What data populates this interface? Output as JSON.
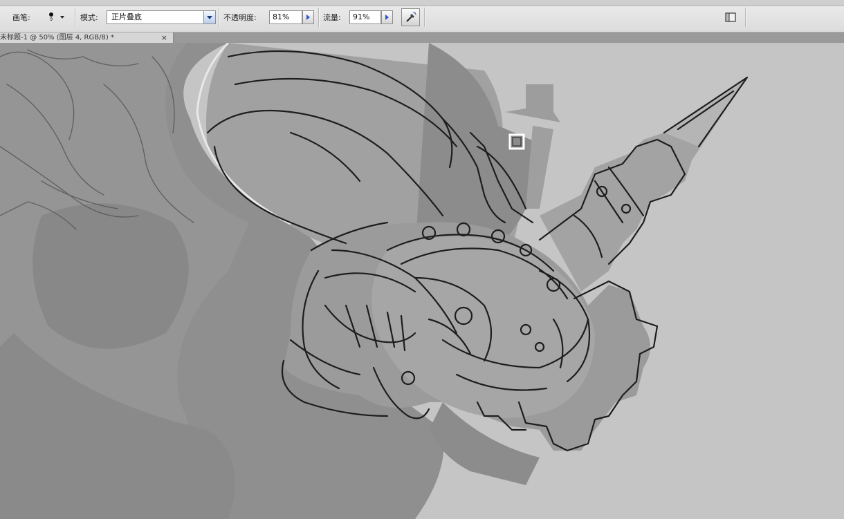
{
  "options_bar": {
    "brush_label": "画笔:",
    "brush_size": "9",
    "mode_label": "模式:",
    "mode_value": "正片叠底",
    "opacity_label": "不透明度:",
    "opacity_value": "81%",
    "flow_label": "流量:",
    "flow_value": "91%"
  },
  "document_tab": {
    "title": "未标题-1 @ 50% (图层 4, RGB/8) *",
    "close_glyph": "×"
  },
  "icons": [
    "brush-preset-icon",
    "dropdown-chevron-icon",
    "stepper-arrow-icon",
    "airbrush-icon",
    "panel-toggle-icon",
    "close-icon",
    "brush-cursor-icon"
  ],
  "colors": {
    "canvas_bg": "#c5c5c5",
    "ink": "#1d1d1d",
    "accent_blue": "#2a59c8"
  }
}
